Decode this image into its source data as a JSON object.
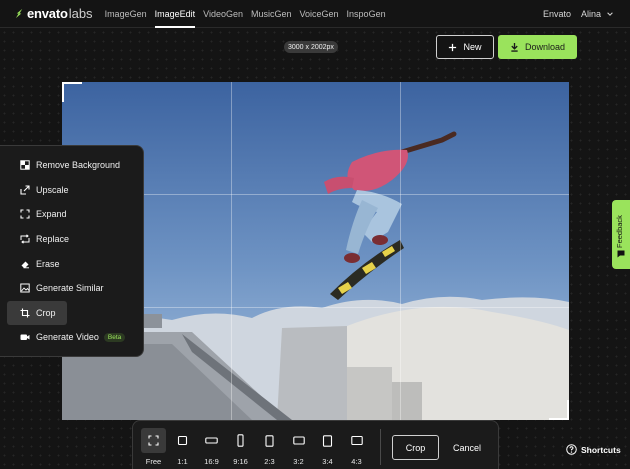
{
  "brand": {
    "name": "envato",
    "suffix": "labs",
    "color": "#9ae35c"
  },
  "nav": {
    "items": [
      {
        "label": "ImageGen",
        "active": false
      },
      {
        "label": "ImageEdit",
        "active": true
      },
      {
        "label": "VideoGen",
        "active": false
      },
      {
        "label": "MusicGen",
        "active": false
      },
      {
        "label": "VoiceGen",
        "active": false
      },
      {
        "label": "InspoGen",
        "active": false
      }
    ]
  },
  "account": {
    "org": "Envato",
    "user": "Alina",
    "chevron_icon": "chevron-down-icon"
  },
  "toolbar": {
    "dimensions": "3000 x 2002px",
    "new_label": "New",
    "new_icon": "plus-icon",
    "download_label": "Download",
    "download_icon": "download-icon"
  },
  "tools": {
    "items": [
      {
        "label": "Remove Background",
        "icon": "remove-background-icon"
      },
      {
        "label": "Upscale",
        "icon": "upscale-icon"
      },
      {
        "label": "Expand",
        "icon": "expand-icon"
      },
      {
        "label": "Replace",
        "icon": "replace-icon"
      },
      {
        "label": "Erase",
        "icon": "eraser-icon"
      },
      {
        "label": "Generate Similar",
        "icon": "image-icon"
      },
      {
        "label": "Crop",
        "icon": "crop-icon",
        "active": true
      },
      {
        "label": "Generate Video",
        "icon": "video-icon",
        "badge": "Beta"
      }
    ]
  },
  "feedback": {
    "label": "Feedback",
    "icon": "feedback-icon"
  },
  "crop_bar": {
    "ratios": [
      {
        "label": "Free",
        "icon": "free-crop-icon",
        "active": true
      },
      {
        "label": "1:1",
        "icon": "ratio-1-1-icon"
      },
      {
        "label": "16:9",
        "icon": "ratio-16-9-icon"
      },
      {
        "label": "9:16",
        "icon": "ratio-9-16-icon"
      },
      {
        "label": "2:3",
        "icon": "ratio-2-3-icon"
      },
      {
        "label": "3:2",
        "icon": "ratio-3-2-icon"
      },
      {
        "label": "3:4",
        "icon": "ratio-3-4-icon"
      },
      {
        "label": "4:3",
        "icon": "ratio-4-3-icon"
      }
    ],
    "crop_label": "Crop",
    "cancel_label": "Cancel"
  },
  "shortcuts": {
    "label": "Shortcuts",
    "icon": "question-circle-icon"
  }
}
